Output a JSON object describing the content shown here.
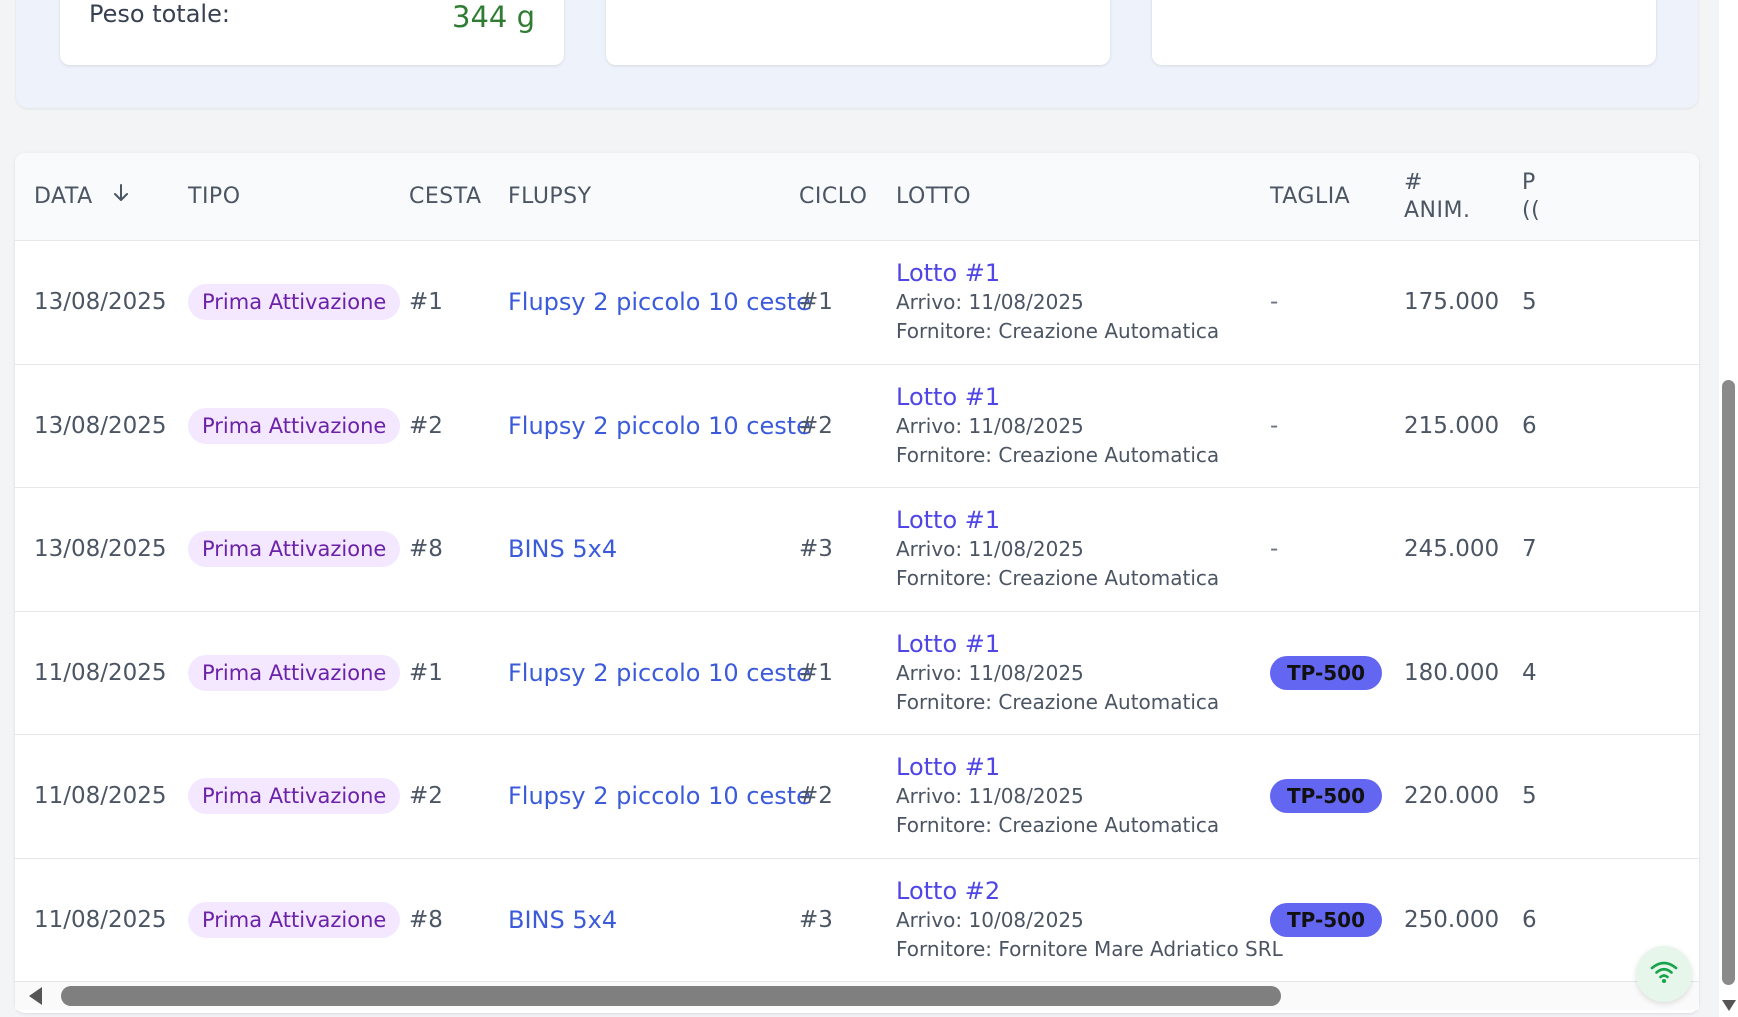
{
  "summary": {
    "cards": [
      {
        "label": "Peso totale:",
        "value": "344 g"
      },
      {
        "label": "",
        "value": ""
      },
      {
        "label": "",
        "value": ""
      }
    ]
  },
  "table": {
    "columns": {
      "data": "DATA",
      "tipo": "TIPO",
      "cesta": "CESTA",
      "flupsy": "FLUPSY",
      "ciclo": "CICLO",
      "lotto": "LOTTO",
      "taglia": "TAGLIA",
      "anim_line1": "#",
      "anim_line2": "ANIM.",
      "next_line1": "P",
      "next_line2": "(("
    },
    "rows": [
      {
        "date": "13/08/2025",
        "type": "Prima Attivazione",
        "cesta": "#1",
        "flupsy": "Flupsy 2 piccolo 10 ceste",
        "ciclo": "#1",
        "lot_name": "Lotto #1",
        "lot_arrival": "Arrivo: 11/08/2025",
        "lot_supplier": "Fornitore: Creazione Automatica",
        "taglia": "-",
        "animals": "175.000",
        "next": "5"
      },
      {
        "date": "13/08/2025",
        "type": "Prima Attivazione",
        "cesta": "#2",
        "flupsy": "Flupsy 2 piccolo 10 ceste",
        "ciclo": "#2",
        "lot_name": "Lotto #1",
        "lot_arrival": "Arrivo: 11/08/2025",
        "lot_supplier": "Fornitore: Creazione Automatica",
        "taglia": "-",
        "animals": "215.000",
        "next": "6"
      },
      {
        "date": "13/08/2025",
        "type": "Prima Attivazione",
        "cesta": "#8",
        "flupsy": "BINS 5x4",
        "ciclo": "#3",
        "lot_name": "Lotto #1",
        "lot_arrival": "Arrivo: 11/08/2025",
        "lot_supplier": "Fornitore: Creazione Automatica",
        "taglia": "-",
        "animals": "245.000",
        "next": "7"
      },
      {
        "date": "11/08/2025",
        "type": "Prima Attivazione",
        "cesta": "#1",
        "flupsy": "Flupsy 2 piccolo 10 ceste",
        "ciclo": "#1",
        "lot_name": "Lotto #1",
        "lot_arrival": "Arrivo: 11/08/2025",
        "lot_supplier": "Fornitore: Creazione Automatica",
        "taglia": "TP-500",
        "animals": "180.000",
        "next": "4"
      },
      {
        "date": "11/08/2025",
        "type": "Prima Attivazione",
        "cesta": "#2",
        "flupsy": "Flupsy 2 piccolo 10 ceste",
        "ciclo": "#2",
        "lot_name": "Lotto #1",
        "lot_arrival": "Arrivo: 11/08/2025",
        "lot_supplier": "Fornitore: Creazione Automatica",
        "taglia": "TP-500",
        "animals": "220.000",
        "next": "5"
      },
      {
        "date": "11/08/2025",
        "type": "Prima Attivazione",
        "cesta": "#8",
        "flupsy": "BINS 5x4",
        "ciclo": "#3",
        "lot_name": "Lotto #2",
        "lot_arrival": "Arrivo: 10/08/2025",
        "lot_supplier": "Fornitore: Fornitore Mare Adriatico SRL",
        "taglia": "TP-500",
        "animals": "250.000",
        "next": "6"
      }
    ]
  },
  "icons": {
    "sort": "arrow-down-icon",
    "status": "wifi-icon",
    "scroll_left": "chevron-left-icon",
    "scroll_down": "chevron-down-icon"
  },
  "colors": {
    "accent_link": "#3b5bdb",
    "lot_link": "#4f46e5",
    "type_badge_bg": "#f3e8ff",
    "type_badge_text": "#6b21a8",
    "size_badge_bg": "#6366f1",
    "weight_value": "#2f7d32"
  }
}
